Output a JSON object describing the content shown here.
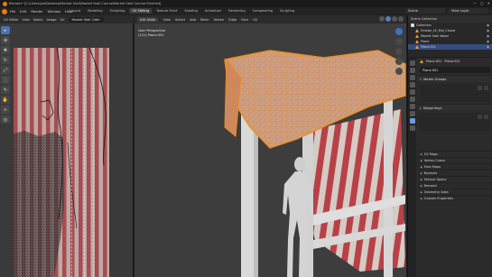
{
  "titlebar": {
    "title": "Blender* [C:\\Users\\Joe\\Desktop\\Market Stall\\Market Stall Course\\Market Stall Course Finished]",
    "controls": [
      "—",
      "▢",
      "✕"
    ]
  },
  "menubar": {
    "menus": [
      "File",
      "Edit",
      "Render",
      "Window",
      "Help"
    ],
    "workspaces": [
      "Layout",
      "Modeling",
      "Sculpting",
      "UV Editing",
      "Texture Paint",
      "Shading",
      "Animation",
      "Rendering",
      "Compositing",
      "Scripting"
    ],
    "active_workspace": "UV Editing",
    "scene": "Scene",
    "view_layer": "View Layer"
  },
  "uv_editor": {
    "mode": "UV Editor",
    "image_name": "Market Stall Cloth",
    "menus": [
      "View",
      "Select",
      "Image",
      "UV"
    ]
  },
  "viewport": {
    "mode": "Edit Mode",
    "menus": [
      "View",
      "Select",
      "Add",
      "Mesh",
      "Vertex",
      "Edge",
      "Face",
      "UV"
    ],
    "view_name": "User Perspective",
    "object_info": "(121) Plane.001"
  },
  "outliner": {
    "header": "Scene Collection",
    "rows": [
      {
        "label": "Collection",
        "icon": "collection-icon"
      },
      {
        "label": "Human_LE_Mid_Crowd",
        "icon": "mesh-icon"
      },
      {
        "label": "Market Stall Wood",
        "icon": "mesh-icon"
      },
      {
        "label": "Plane",
        "icon": "mesh-icon"
      },
      {
        "label": "Plane.001",
        "icon": "mesh-icon",
        "selected": true
      }
    ]
  },
  "properties": {
    "object_name": "Plane.001",
    "data_name": "Plane.001",
    "field_value": "Plane.001",
    "sections": [
      "Vertex Groups",
      "Shape Keys"
    ],
    "collapsed": [
      "UV Maps",
      "Vertex Colors",
      "Face Maps",
      "Normals",
      "Texture Space",
      "Remesh",
      "Geometry Data",
      "Custom Properties"
    ]
  },
  "colors": {
    "accent": "#e87d0d",
    "selection": "#334d80",
    "wire_orange": "#e8811e"
  }
}
